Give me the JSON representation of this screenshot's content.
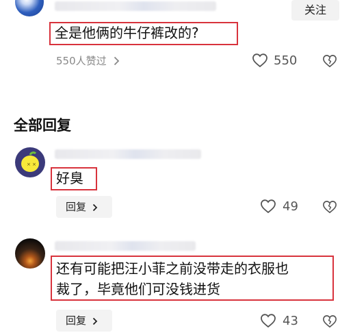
{
  "post": {
    "follow_label": "关注",
    "text": "全是他俩的牛仔裤改的?",
    "likes_summary": "550人赞过",
    "chevron": "›",
    "like_count": "550"
  },
  "section": {
    "title": "全部回复"
  },
  "replies": [
    {
      "text": "好臭",
      "reply_label": "回复",
      "chevron": "›",
      "like_count": "49"
    },
    {
      "text_line1": "还有可能把汪小菲之前没带走的衣服也",
      "text_line2": "裁了，毕竟他们可没钱进货",
      "reply_label": "回复",
      "chevron": "›",
      "like_count": "43"
    }
  ],
  "colors": {
    "highlight_border": "#d8323c",
    "muted_text": "#888888",
    "button_bg": "#f3f3f3"
  },
  "icons": [
    "avatar-image",
    "heart-outline-icon",
    "heart-broken-icon",
    "chevron-right-icon"
  ]
}
